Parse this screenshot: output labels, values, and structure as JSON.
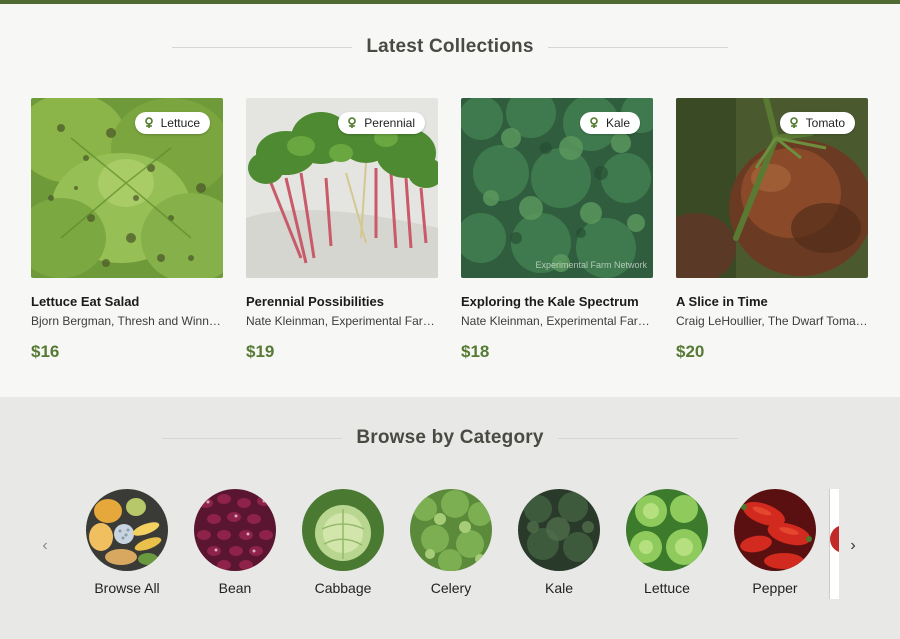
{
  "latest": {
    "title": "Latest Collections",
    "cards": [
      {
        "tag": "Lettuce",
        "title": "Lettuce Eat Salad",
        "authors": "Bjorn Bergman, Thresh and Winnow, ...",
        "price": "$16",
        "watermark": ""
      },
      {
        "tag": "Perennial",
        "title": "Perennial Possibilities",
        "authors": "Nate Kleinman, Experimental Farm Network",
        "price": "$19",
        "watermark": ""
      },
      {
        "tag": "Kale",
        "title": "Exploring the Kale Spectrum",
        "authors": "Nate Kleinman, Experimental Farm Network",
        "price": "$18",
        "watermark": "Experimental Farm Network"
      },
      {
        "tag": "Tomato",
        "title": "A Slice in Time",
        "authors": "Craig LeHoullier, The Dwarf Tomato Project",
        "price": "$20",
        "watermark": ""
      }
    ]
  },
  "browse": {
    "title": "Browse by Category",
    "prev_icon": "chevron-left-icon",
    "next_icon": "chevron-right-icon",
    "categories": [
      {
        "label": "Browse All"
      },
      {
        "label": "Bean"
      },
      {
        "label": "Cabbage"
      },
      {
        "label": "Celery"
      },
      {
        "label": "Kale"
      },
      {
        "label": "Lettuce"
      },
      {
        "label": "Pepper"
      }
    ]
  },
  "colors": {
    "accent": "#567a33",
    "topbar": "#4f6b32",
    "browse_bg": "#e8e8e6"
  }
}
